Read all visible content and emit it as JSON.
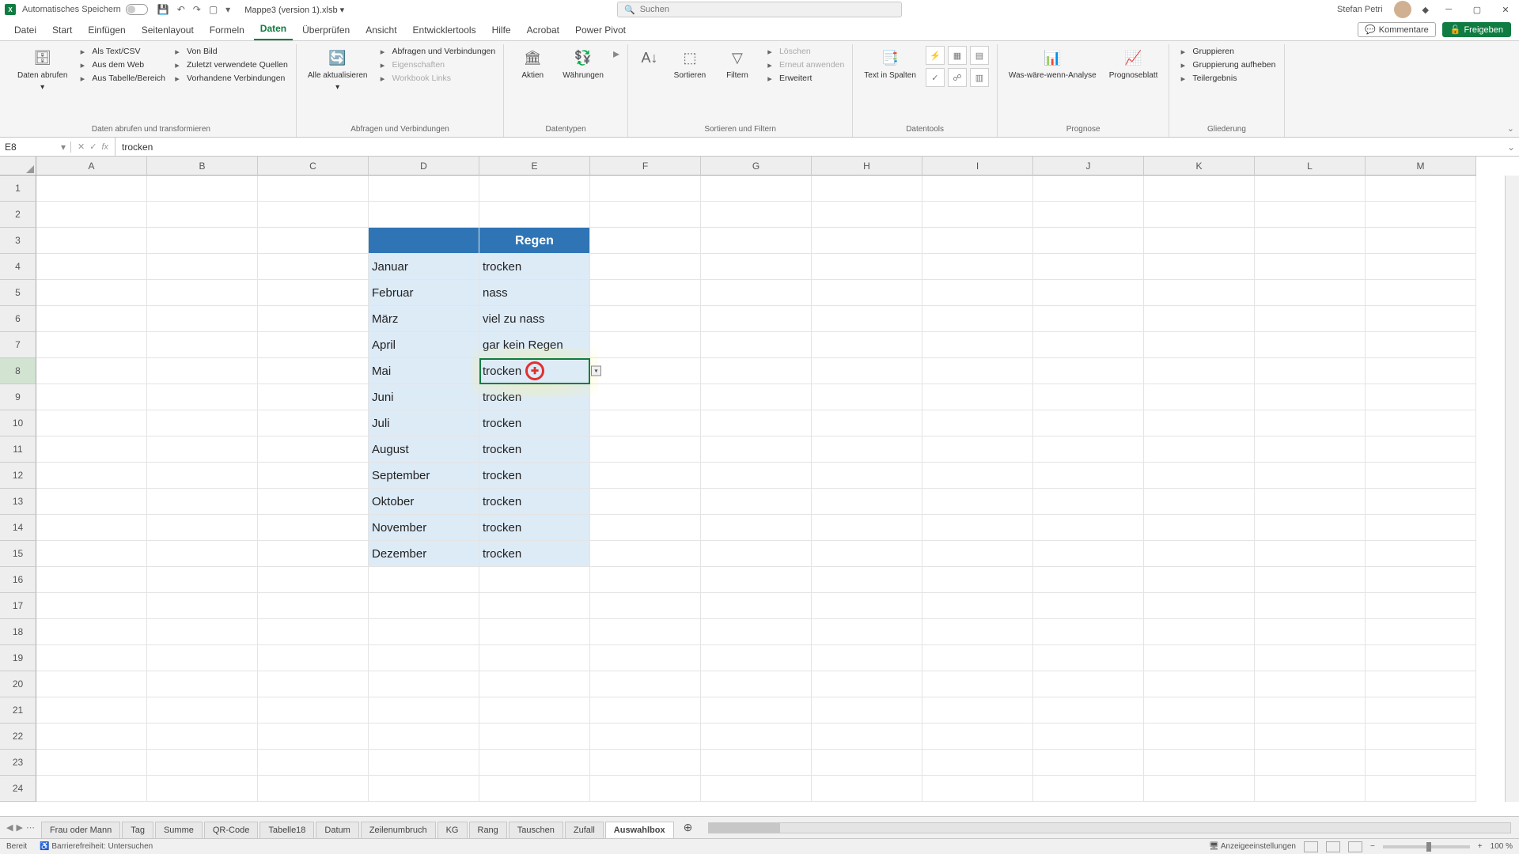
{
  "title": {
    "autosave": "Automatisches Speichern",
    "filename": "Mappe3 (version 1).xlsb",
    "search_placeholder": "Suchen",
    "user": "Stefan Petri"
  },
  "tabs": {
    "items": [
      "Datei",
      "Start",
      "Einfügen",
      "Seitenlayout",
      "Formeln",
      "Daten",
      "Überprüfen",
      "Ansicht",
      "Entwicklertools",
      "Hilfe",
      "Acrobat",
      "Power Pivot"
    ],
    "active": 5,
    "comments": "Kommentare",
    "share": "Freigeben"
  },
  "ribbon": {
    "g1": {
      "big": "Daten abrufen",
      "items": [
        "Als Text/CSV",
        "Aus dem Web",
        "Aus Tabelle/Bereich",
        "Von Bild",
        "Zuletzt verwendete Quellen",
        "Vorhandene Verbindungen"
      ],
      "label": "Daten abrufen und transformieren"
    },
    "g2": {
      "big": "Alle aktualisieren",
      "items": [
        "Abfragen und Verbindungen",
        "Eigenschaften",
        "Workbook Links"
      ],
      "label": "Abfragen und Verbindungen"
    },
    "g3": {
      "l": "Aktien",
      "r": "Währungen",
      "label": "Datentypen"
    },
    "g4": {
      "b1": "Sortieren",
      "b2": "Filtern",
      "items": [
        "Löschen",
        "Erneut anwenden",
        "Erweitert"
      ],
      "label": "Sortieren und Filtern"
    },
    "g5": {
      "big": "Text in Spalten",
      "label": "Datentools"
    },
    "g6": {
      "b1": "Was-wäre-wenn-Analyse",
      "b2": "Prognoseblatt",
      "label": "Prognose"
    },
    "g7": {
      "items": [
        "Gruppieren",
        "Gruppierung aufheben",
        "Teilergebnis"
      ],
      "label": "Gliederung"
    }
  },
  "namebox": "E8",
  "formula": "trocken",
  "columns": [
    "A",
    "B",
    "C",
    "D",
    "E",
    "F",
    "G",
    "H",
    "I",
    "J",
    "K",
    "L",
    "M"
  ],
  "table": {
    "header": {
      "e": "Regen"
    },
    "rows": [
      {
        "d": "Januar",
        "e": "trocken"
      },
      {
        "d": "Februar",
        "e": "nass"
      },
      {
        "d": "März",
        "e": "viel zu nass"
      },
      {
        "d": "April",
        "e": "gar kein Regen"
      },
      {
        "d": "Mai",
        "e": "trocken"
      },
      {
        "d": "Juni",
        "e": "trocken"
      },
      {
        "d": "Juli",
        "e": "trocken"
      },
      {
        "d": "August",
        "e": "trocken"
      },
      {
        "d": "September",
        "e": "trocken"
      },
      {
        "d": "Oktober",
        "e": "trocken"
      },
      {
        "d": "November",
        "e": "trocken"
      },
      {
        "d": "Dezember",
        "e": "trocken"
      }
    ]
  },
  "selected_row": 8,
  "sheets": {
    "items": [
      "Frau oder Mann",
      "Tag",
      "Summe",
      "QR-Code",
      "Tabelle18",
      "Datum",
      "Zeilenumbruch",
      "KG",
      "Rang",
      "Tauschen",
      "Zufall",
      "Auswahlbox"
    ],
    "active": 11
  },
  "status": {
    "ready": "Bereit",
    "access": "Barrierefreiheit: Untersuchen",
    "display": "Anzeigeeinstellungen",
    "zoom": "100 %"
  }
}
